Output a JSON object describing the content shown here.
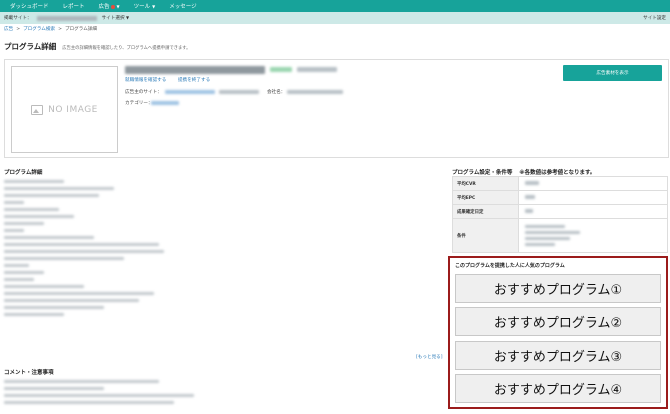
{
  "topnav": {
    "items": [
      "ダッシュボード",
      "レポート",
      "広告",
      "ツール",
      "メッセージ"
    ]
  },
  "subnav": {
    "site_label": "掲載サイト：",
    "site_select": "サイト選択",
    "right": "サイト設定"
  },
  "breadcrumb": {
    "items": [
      "広告",
      "プログラム検索",
      "プログラム詳細"
    ]
  },
  "page": {
    "title": "プログラム詳細",
    "description": "広告主の詳細情報を確認したり、プログラムへ提携申請できます。"
  },
  "program": {
    "noimage": "NO IMAGE",
    "link1": "就職情報を確認する",
    "link2": "提携を終了する",
    "advertiser_site_label": "広告主のサイト：",
    "company_label": "会社名：",
    "category_label": "カテゴリー：",
    "cta_label": "広告素材を表示"
  },
  "detail": {
    "heading": "プログラム詳細",
    "more": "[もっと見る]"
  },
  "comment": {
    "heading": "コメント・注意事項"
  },
  "conditions": {
    "heading": "プログラム設定・条件等",
    "note": "※各数値は参考値となります。",
    "rows": [
      {
        "key": "平均CVR"
      },
      {
        "key": "平均EPC"
      },
      {
        "key": "成果確定日定"
      },
      {
        "key": "条件"
      }
    ]
  },
  "recommend": {
    "heading": "このプログラムを提携した人に人気のプログラム",
    "items": [
      "おすすめプログラム①",
      "おすすめプログラム②",
      "おすすめプログラム③",
      "おすすめプログラム④"
    ]
  }
}
